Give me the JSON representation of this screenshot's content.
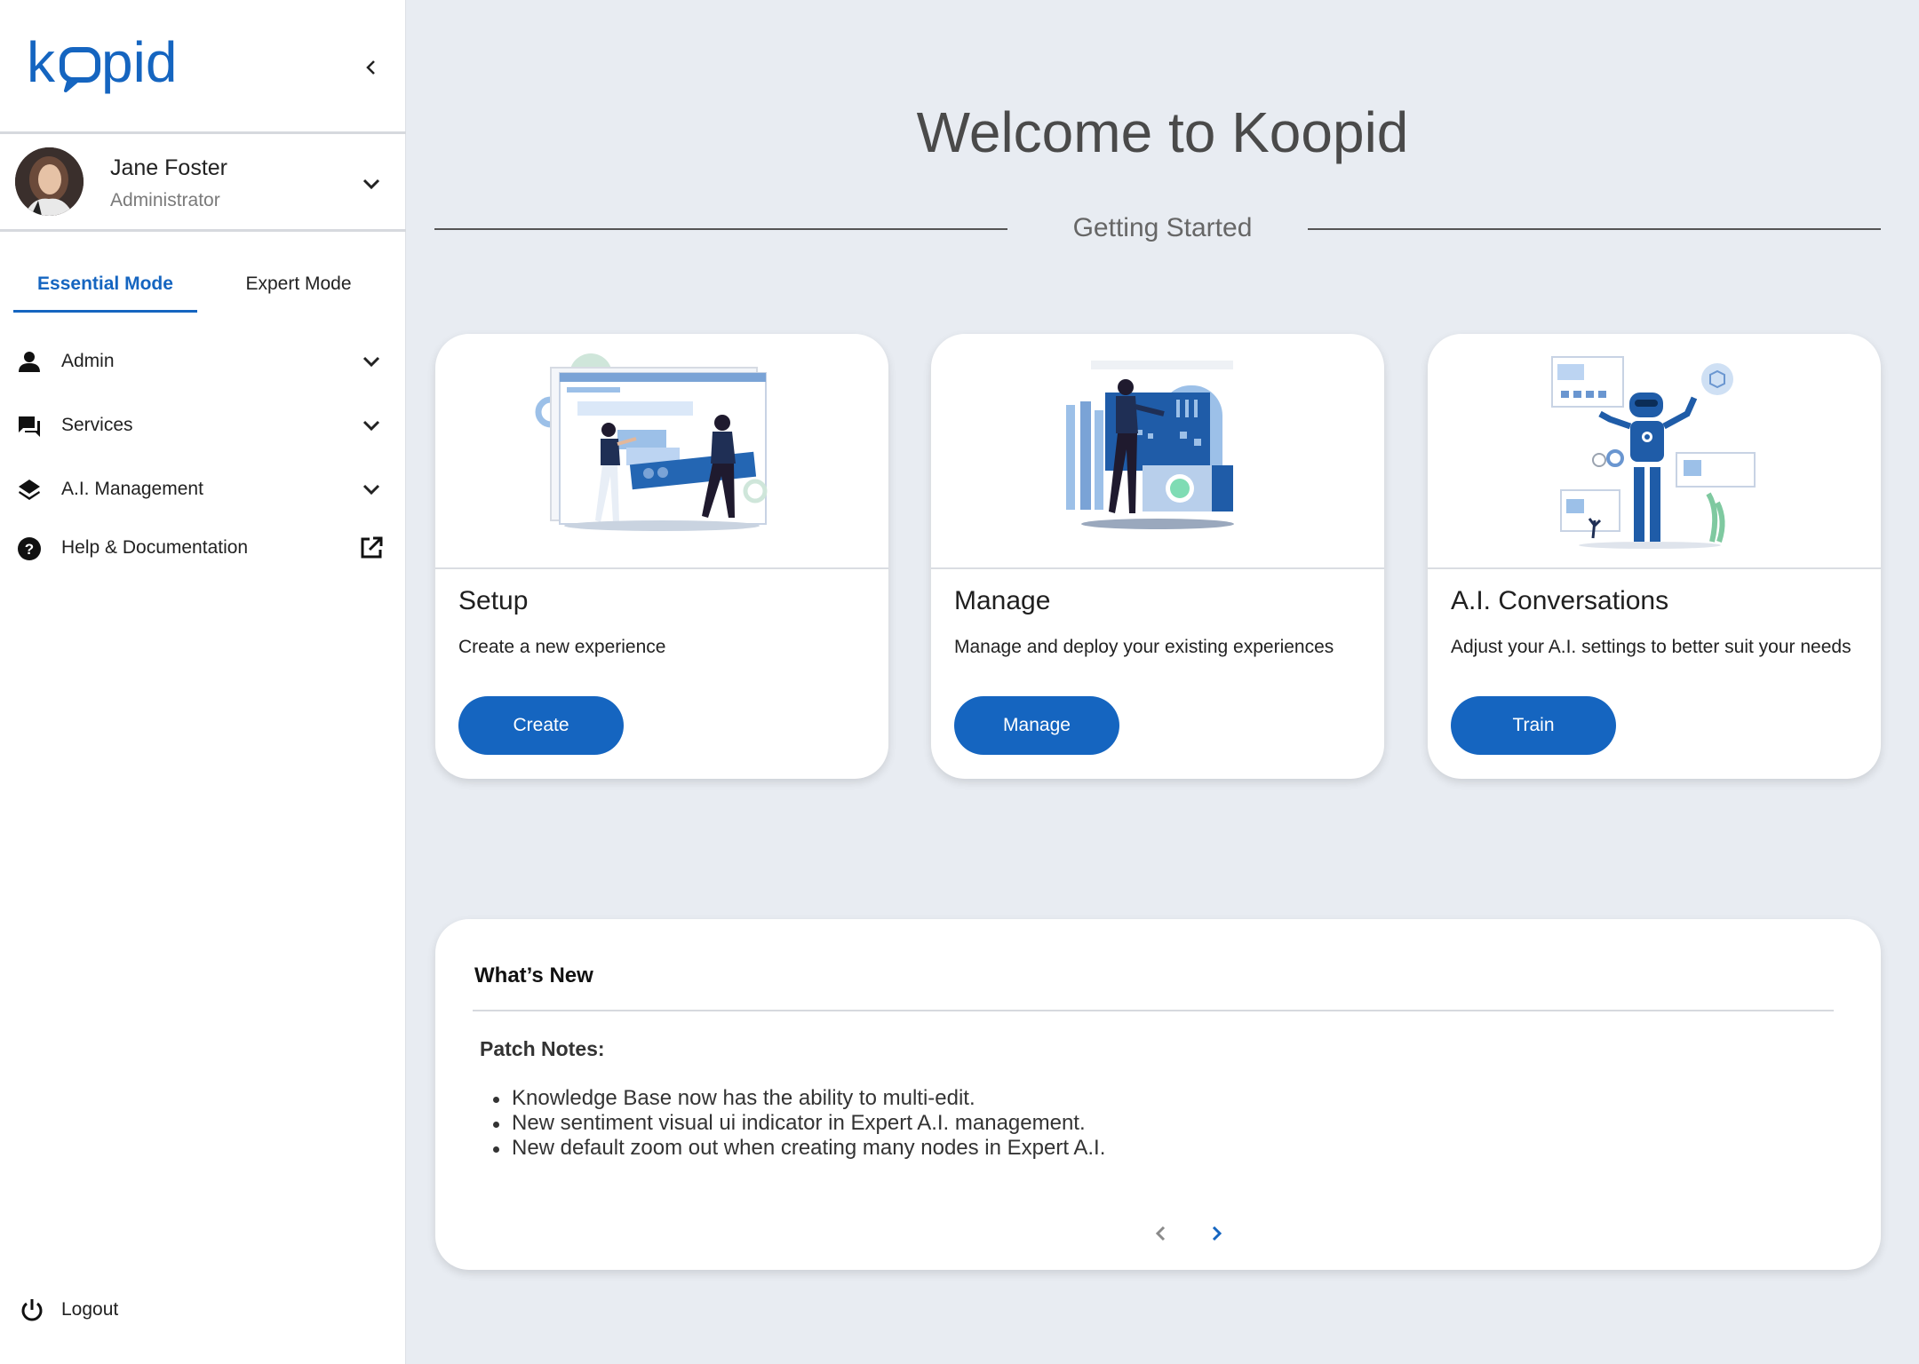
{
  "brand": {
    "name": "koopid",
    "accent": "#1565c0"
  },
  "sidebar": {
    "user": {
      "name": "Jane Foster",
      "role": "Administrator"
    },
    "tabs": [
      {
        "label": "Essential Mode",
        "active": true
      },
      {
        "label": "Expert Mode",
        "active": false
      }
    ],
    "items": [
      {
        "label": "Admin",
        "icon": "person-icon"
      },
      {
        "label": "Services",
        "icon": "chat-icon"
      },
      {
        "label": "A.I. Management",
        "icon": "layers-icon"
      },
      {
        "label": "Help & Documentation",
        "icon": "help-icon"
      }
    ],
    "logout": "Logout"
  },
  "main": {
    "title": "Welcome to Koopid",
    "section": "Getting Started",
    "cards": [
      {
        "title": "Setup",
        "description": "Create a new experience",
        "button": "Create"
      },
      {
        "title": "Manage",
        "description": "Manage and deploy your existing experiences",
        "button": "Manage"
      },
      {
        "title": "A.I. Conversations",
        "description": "Adjust your A.I. settings to better suit your needs",
        "button": "Train"
      }
    ],
    "news": {
      "title": "What’s New",
      "subtitle": "Patch Notes:",
      "items": [
        "Knowledge Base now has the ability to multi-edit.",
        "New sentiment visual ui indicator in Expert A.I. management.",
        "New default zoom out when creating many nodes in Expert A.I."
      ]
    }
  }
}
